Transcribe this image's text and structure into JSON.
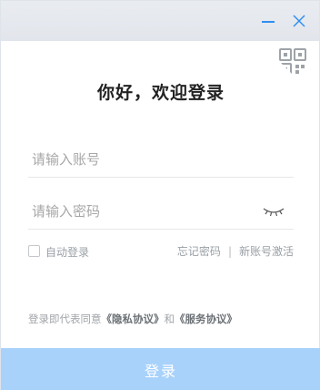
{
  "window": {
    "title": "你好，欢迎登录",
    "minimize_icon": "minimize-icon",
    "close_icon": "close-icon",
    "qr_icon": "qr-code-icon"
  },
  "form": {
    "account_placeholder": "请输入账号",
    "account_value": "",
    "password_placeholder": "请输入密码",
    "password_value": "",
    "password_toggle_icon": "eye-closed-icon"
  },
  "options": {
    "auto_login_label": "自动登录",
    "auto_login_checked": false,
    "forgot_password": "忘记密码",
    "separator": "|",
    "activate_account": "新账号激活"
  },
  "agreement": {
    "prefix": "登录即代表同意",
    "privacy": "《隐私协议》",
    "conjunction": "和",
    "service": "《服务协议》"
  },
  "login_button": "登录",
  "colors": {
    "accent": "#2f8ff0",
    "button_disabled": "#a9d2fb",
    "titlebar": "#e6e9ee"
  }
}
